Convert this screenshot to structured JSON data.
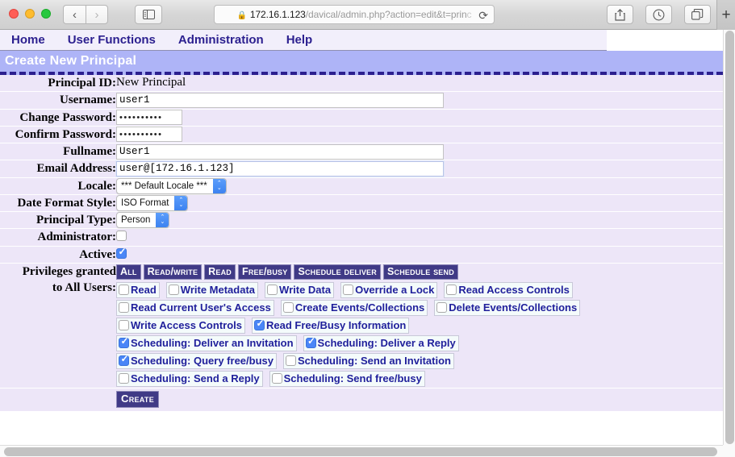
{
  "browser": {
    "traffic_lights": [
      "close",
      "minimize",
      "zoom"
    ],
    "back_label": "‹",
    "forward_label": "›",
    "url": {
      "lock_icon": "lock-icon",
      "host": "172.16.1.123",
      "path": "/davical/admin.php?action=edit&t=prin",
      "truncated_tail": "c",
      "full_display": "172.16.1.123/davical/admin.php?action=edit&t=princ"
    },
    "reload_icon": "reload-icon",
    "toolbar_icons": [
      "sidebar-icon",
      "share-icon",
      "history-icon",
      "tab-overview-icon",
      "new-tab-icon"
    ],
    "new_tab_label": "+"
  },
  "site_nav": {
    "items": [
      {
        "label": "Home"
      },
      {
        "label": "User Functions"
      },
      {
        "label": "Administration"
      },
      {
        "label": "Help"
      }
    ]
  },
  "page": {
    "title": "Create New Principal"
  },
  "form": {
    "rows": [
      {
        "label": "Principal ID:",
        "type": "static",
        "value": "New Principal"
      },
      {
        "label": "Username:",
        "type": "text",
        "value": "user1"
      },
      {
        "label": "Change Password:",
        "type": "password",
        "value": "••••••••••"
      },
      {
        "label": "Confirm Password:",
        "type": "password",
        "value": "••••••••••"
      },
      {
        "label": "Fullname:",
        "type": "text",
        "value": "User1"
      },
      {
        "label": "Email Address:",
        "type": "text",
        "value": "user@[172.16.1.123]"
      },
      {
        "label": "Locale:",
        "type": "select",
        "value": "*** Default Locale ***"
      },
      {
        "label": "Date Format Style:",
        "type": "select",
        "value": "ISO Format"
      },
      {
        "label": "Principal Type:",
        "type": "select",
        "value": "Person"
      },
      {
        "label": "Administrator:",
        "type": "checkbox",
        "checked": false
      },
      {
        "label": "Active:",
        "type": "checkbox",
        "checked": true
      }
    ],
    "privileges_label_line1": "Privileges granted",
    "privileges_label_line2": "to All Users:",
    "privilege_buttons": [
      {
        "label": "All"
      },
      {
        "label": "Read/Write"
      },
      {
        "label": "Read"
      },
      {
        "label": "Free/Busy"
      },
      {
        "label": "Schedule Deliver"
      },
      {
        "label": "Schedule Send"
      }
    ],
    "privilege_checkboxes": [
      [
        {
          "label": "Read",
          "checked": false
        },
        {
          "label": "Write Metadata",
          "checked": false
        },
        {
          "label": "Write Data",
          "checked": false
        },
        {
          "label": "Override a Lock",
          "checked": false
        },
        {
          "label": "Read Access Controls",
          "checked": false
        }
      ],
      [
        {
          "label": "Read Current User's Access",
          "checked": false
        },
        {
          "label": "Create Events/Collections",
          "checked": false
        },
        {
          "label": "Delete Events/Collections",
          "checked": false
        }
      ],
      [
        {
          "label": "Write Access Controls",
          "checked": false
        },
        {
          "label": "Read Free/Busy Information",
          "checked": true
        }
      ],
      [
        {
          "label": "Scheduling: Deliver an Invitation",
          "checked": true
        },
        {
          "label": "Scheduling: Deliver a Reply",
          "checked": true
        }
      ],
      [
        {
          "label": "Scheduling: Query free/busy",
          "checked": true
        },
        {
          "label": "Scheduling: Send an Invitation",
          "checked": false
        }
      ],
      [
        {
          "label": "Scheduling: Send a Reply",
          "checked": false
        },
        {
          "label": "Scheduling: Send free/busy",
          "checked": false
        }
      ]
    ],
    "submit_label": "Create"
  },
  "colors": {
    "header_bg": "#aeb4f7",
    "row_bg": "#ede6f8",
    "nav_bg": "#f2effb",
    "link_blue": "#2b1f8f",
    "priv_purple": "#403a86",
    "checkbox_blue": "#4a86f7"
  }
}
